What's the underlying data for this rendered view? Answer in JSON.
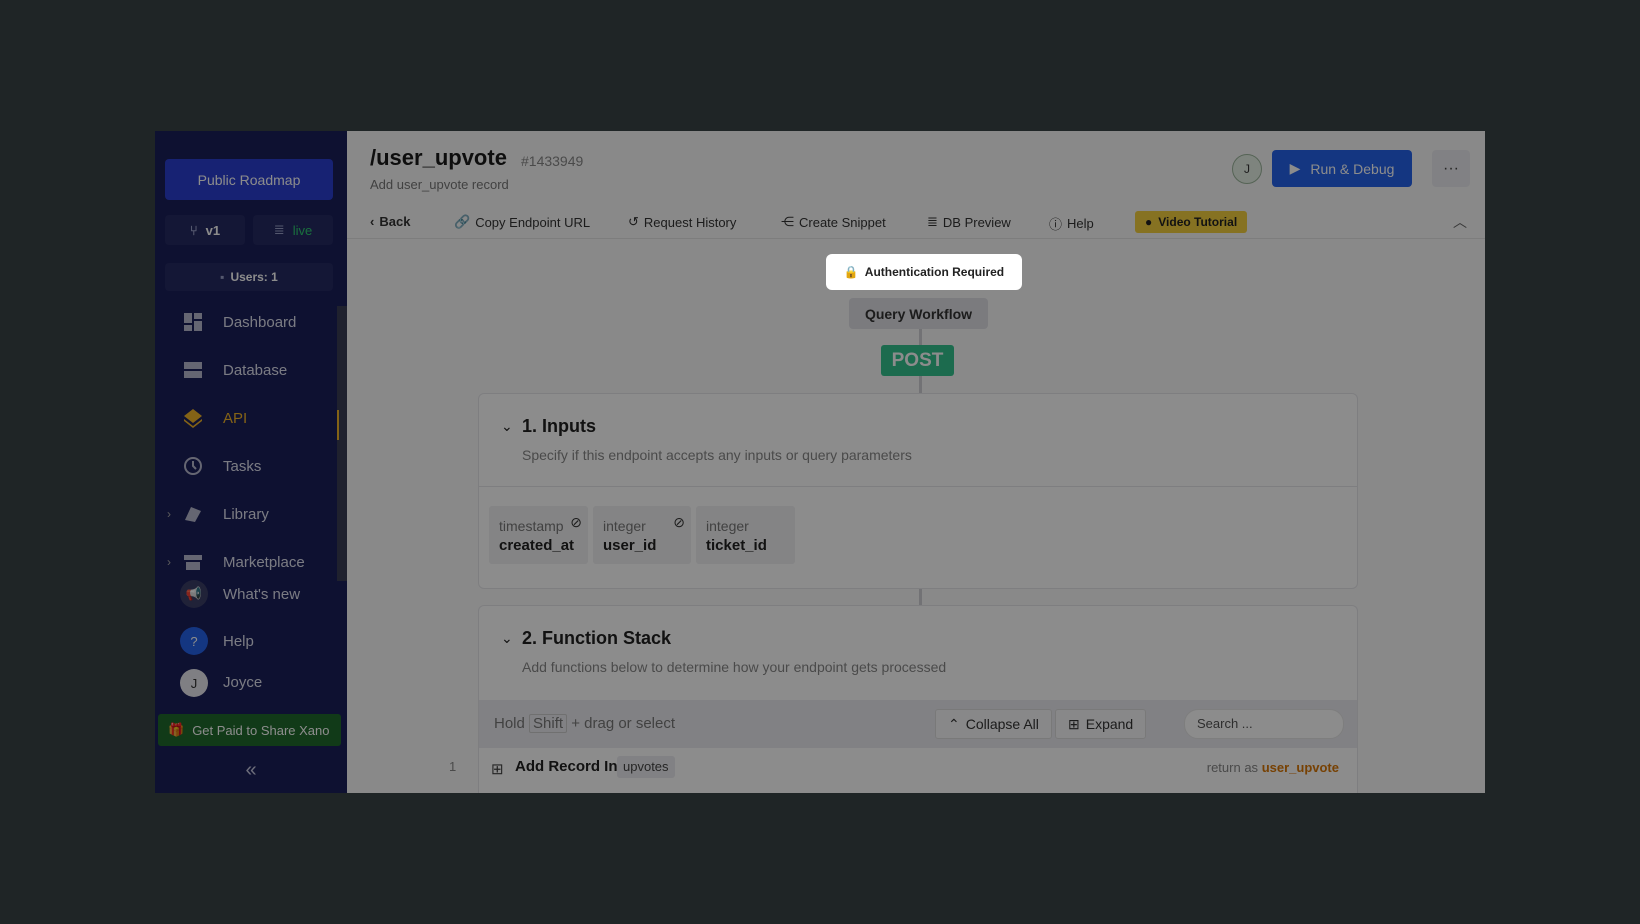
{
  "sidebar": {
    "project_button": "Public Roadmap",
    "branch": "v1",
    "datasource": "live",
    "users": "Users: 1",
    "nav": [
      {
        "label": "Dashboard"
      },
      {
        "label": "Database"
      },
      {
        "label": "API"
      },
      {
        "label": "Tasks"
      },
      {
        "label": "Library"
      },
      {
        "label": "Marketplace"
      }
    ],
    "whats_new": "What's new",
    "help": "Help",
    "user_initial": "J",
    "user_name": "Joyce",
    "promo": "Get Paid to Share Xano",
    "accent_active": "#f0b429"
  },
  "header": {
    "title": "/user_upvote",
    "id": "#1433949",
    "subtitle": "Add user_upvote record",
    "avatar_initial": "J",
    "run_label": "Run & Debug",
    "more_label": "···"
  },
  "toolbar": {
    "back": "Back",
    "copy_url": "Copy Endpoint URL",
    "history": "Request History",
    "snippet": "Create Snippet",
    "db_preview": "DB Preview",
    "help": "Help",
    "video": "Video Tutorial"
  },
  "canvas": {
    "auth": "Authentication Required",
    "workflow": "Query Workflow",
    "method": "POST",
    "inputs": {
      "title": "1. Inputs",
      "desc": "Specify if this endpoint accepts any inputs or query parameters",
      "fields": [
        {
          "type": "timestamp",
          "name": "created_at"
        },
        {
          "type": "integer",
          "name": "user_id"
        },
        {
          "type": "integer",
          "name": "ticket_id"
        }
      ]
    },
    "stack": {
      "title": "2. Function Stack",
      "desc": "Add functions below to determine how your endpoint gets processed",
      "hold_pre": "Hold",
      "hold_key": "Shift",
      "hold_post": "+ drag or select",
      "collapse_all": "Collapse All",
      "expand": "Expand",
      "search_placeholder": "Search ...",
      "rows": [
        {
          "num": "1",
          "title": "Add Record In",
          "table": "upvotes",
          "return_pre": "return as",
          "return_var": "user_upvote"
        }
      ]
    }
  }
}
